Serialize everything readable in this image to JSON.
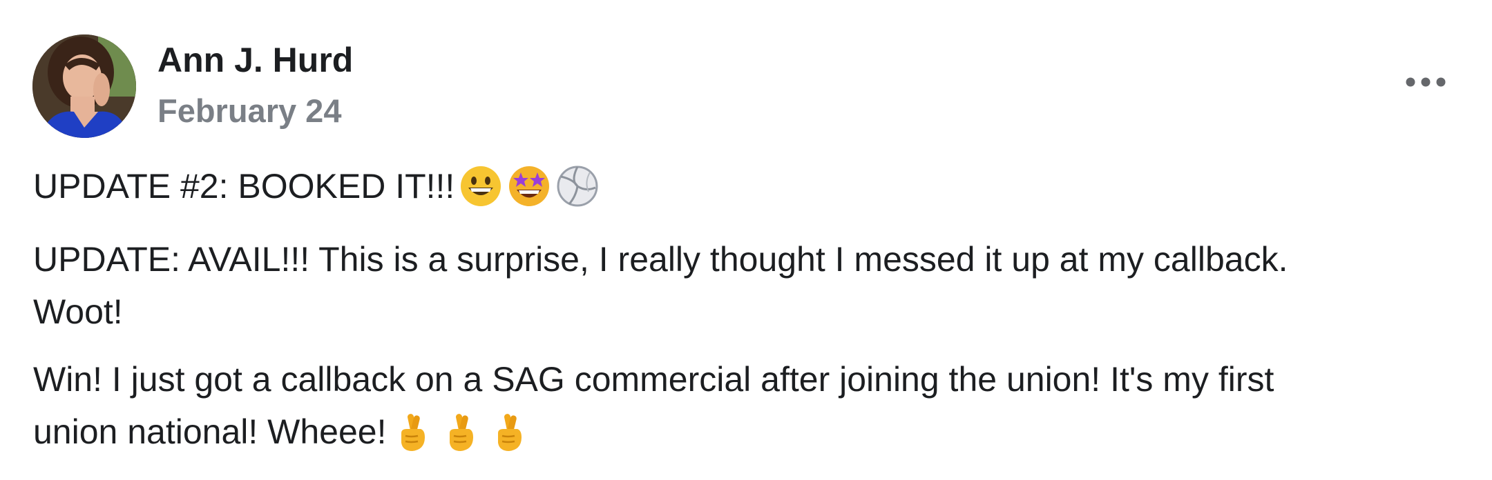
{
  "post": {
    "author_name": "Ann J. Hurd",
    "date": "February 24",
    "more_icon": "more-horizontal-icon",
    "paragraphs": [
      {
        "lines": [
          "UPDATE #2: BOOKED IT!!!"
        ],
        "emojis": [
          "grinning-face-icon",
          "star-struck-face-icon",
          "volleyball-icon"
        ]
      },
      {
        "lines": [
          "UPDATE: AVAIL!!! This is a surprise, I really thought I messed it up at my callback.",
          "Woot!"
        ],
        "emojis": []
      },
      {
        "lines": [
          "Win! I just got a callback on a SAG commercial after joining the union! It's my first",
          "union national! Wheee!"
        ],
        "emojis": [
          "crossed-fingers-icon",
          "crossed-fingers-icon",
          "crossed-fingers-icon"
        ]
      }
    ]
  },
  "colors": {
    "text": "#1c1e21",
    "secondary_text": "#7a7f86",
    "background": "#ffffff"
  }
}
